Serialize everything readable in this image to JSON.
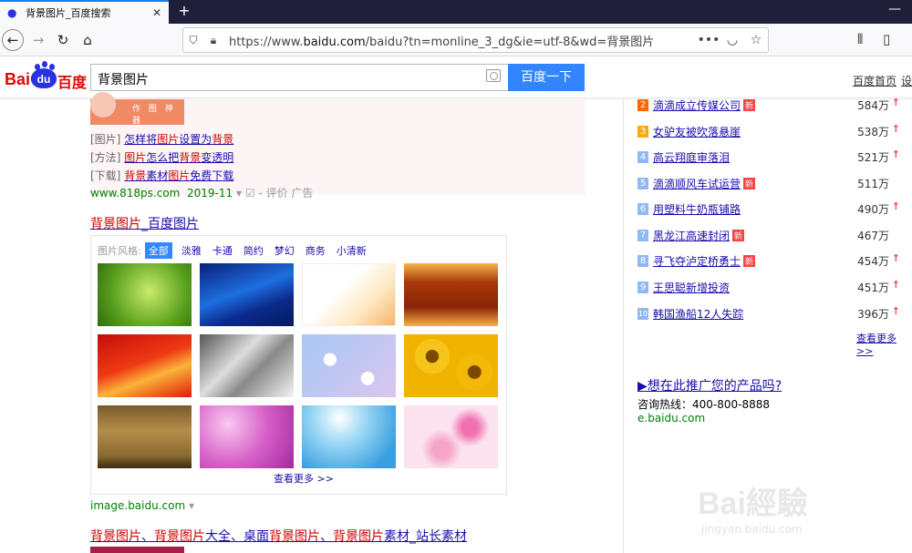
{
  "browser": {
    "tab_title": "背景图片_百度搜索",
    "tab_close": "✕",
    "new_tab": "+",
    "url_prefix": "https://www.",
    "url_domain": "baidu.com",
    "url_rest": "/baidu?tn=monline_3_dg&ie=utf-8&wd=背景图片",
    "url_more": "•••"
  },
  "header": {
    "logo_bai": "Bai",
    "logo_du": "du",
    "logo_baidu": "百度",
    "query": "背景图片",
    "search_button": "百度一下",
    "home_link": "百度首页",
    "settings_link": "设"
  },
  "ad": {
    "image_text": "作 图 神 器",
    "lines": [
      {
        "tag": "[图片]",
        "pre": "怎样将",
        "em1": "图片",
        "mid": "设置为",
        "em2": "背景",
        "post": ""
      },
      {
        "tag": "[方法]",
        "pre": "",
        "em1": "图片",
        "mid": "怎么把",
        "em2": "背景",
        "post": "变透明"
      },
      {
        "tag": "[下载]",
        "pre": "",
        "em1": "背景",
        "mid": "素材",
        "em2": "图片",
        "post": "免费下载"
      }
    ],
    "site": "www.818ps.com",
    "date": "2019-11",
    "eval": "- 评价",
    "ad_label": "广告"
  },
  "image_result": {
    "title_em": "背景图片",
    "title_rest": "_百度图片",
    "style_label": "图片风格:",
    "styles": [
      "全部",
      "淡雅",
      "卡通",
      "简约",
      "梦幻",
      "商务",
      "小清新"
    ],
    "more": "查看更多 >>",
    "source": "image.baidu.com"
  },
  "hot_list": [
    {
      "rank": "2",
      "title": "滴滴成立传媒公司",
      "new": "新",
      "value": "584万",
      "color": "#f60"
    },
    {
      "rank": "3",
      "title": "女驴友被吹落悬崖",
      "new": "",
      "value": "538万",
      "color": "#faa90e"
    },
    {
      "rank": "4",
      "title": "高云翔庭审落泪",
      "new": "",
      "value": "521万",
      "color": "#8eb9f5"
    },
    {
      "rank": "5",
      "title": "滴滴顺风车试运营",
      "new": "新",
      "value": "511万",
      "color": "#8eb9f5"
    },
    {
      "rank": "6",
      "title": "用塑料牛奶瓶铺路",
      "new": "",
      "value": "490万",
      "color": "#8eb9f5"
    },
    {
      "rank": "7",
      "title": "黑龙江高速封闭",
      "new": "新",
      "value": "467万",
      "color": "#8eb9f5"
    },
    {
      "rank": "8",
      "title": "寻飞夺泸定桥勇士",
      "new": "新",
      "value": "454万",
      "color": "#8eb9f5"
    },
    {
      "rank": "9",
      "title": "王思聪新增投资",
      "new": "",
      "value": "451万",
      "color": "#8eb9f5"
    },
    {
      "rank": "10",
      "title": "韩国渔船12人失踪",
      "new": "",
      "value": "396万",
      "color": "#8eb9f5"
    }
  ],
  "hot_more": "查看更多>>",
  "promo": {
    "title": "▶想在此推广您的产品吗?",
    "phone": "咨询热线：400-800-8888",
    "site": "e.baidu.com"
  },
  "next_result": {
    "em1": "背景图片",
    "sep": "、",
    "em2": "背景图片",
    "mid": "大全、桌面",
    "em3": "背景图片",
    "sep2": "、",
    "em4": "背景图片",
    "post": "素材_站长素材"
  },
  "watermark": {
    "big": "Bai經驗",
    "small": "jingyan.baidu.com"
  },
  "colors": {
    "accent": "#3385ff",
    "link": "#1a0dab",
    "highlight": "#c00",
    "green": "#008000"
  }
}
